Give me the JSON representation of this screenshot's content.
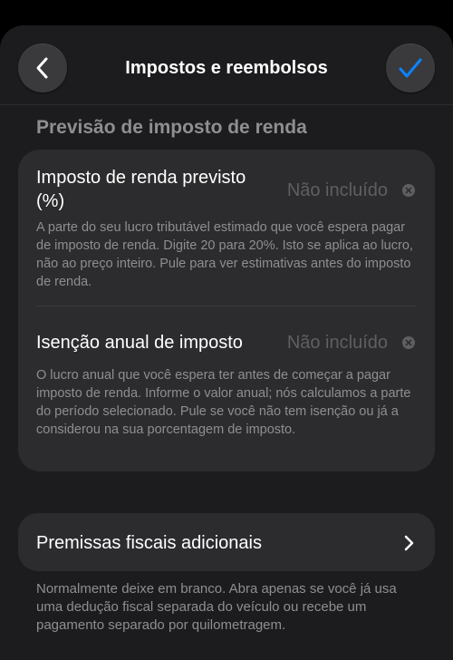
{
  "nav": {
    "title": "Impostos e reembolsos",
    "back_icon": "chevron-left-icon",
    "done_icon": "checkmark-icon",
    "accent_color": "#0a84ff"
  },
  "section": {
    "header": "Previsão de imposto de renda"
  },
  "rows": [
    {
      "label": "Imposto de renda previsto (%)",
      "value_placeholder": "Não incluído",
      "clear_icon": "clear-icon",
      "help": "A parte do seu lucro tributável estimado que você espera pagar de imposto de renda. Digite 20 para 20%. Isto se aplica ao lucro, não ao preço inteiro. Pule para ver estimativas antes do imposto de renda."
    },
    {
      "label": "Isenção anual de imposto",
      "value_placeholder": "Não incluído",
      "clear_icon": "clear-icon",
      "help": "O lucro anual que você espera ter antes de começar a pagar imposto de renda. Informe o valor anual; nós calculamos a parte do período selecionado. Pule se você não tem isenção ou já a considerou na sua porcentagem de imposto."
    }
  ],
  "disclosure": {
    "label": "Premissas fiscais adicionais",
    "icon": "chevron-right-icon"
  },
  "footer": {
    "text": "Normalmente deixe em branco. Abra apenas se você já usa uma dedução fiscal separada do veículo ou recebe um pagamento separado por quilometragem."
  },
  "colors": {
    "background": "#000000",
    "sheet": "#1c1c1e",
    "card": "#2c2c2e",
    "button": "#3a3a3c",
    "secondary_text": "#8e8e93",
    "placeholder_text": "#5f5f63"
  }
}
